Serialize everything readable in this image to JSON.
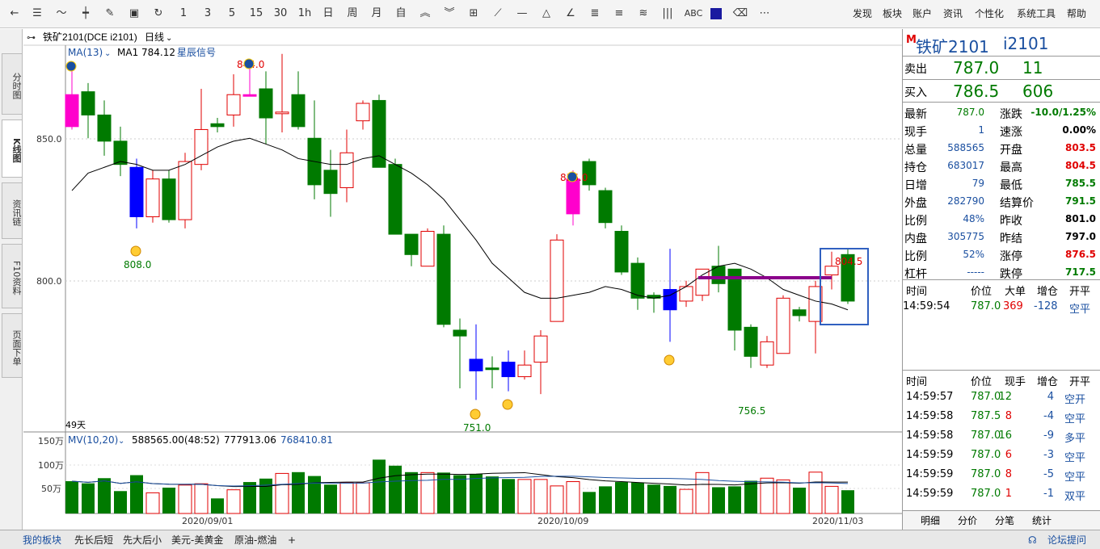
{
  "toolbar": {
    "icons": [
      "back-icon",
      "list-icon",
      "line-chart-icon",
      "candle-icon",
      "adjust-icon",
      "save-icon",
      "refresh-icon"
    ],
    "periods": [
      "1",
      "3",
      "5",
      "15",
      "30",
      "1h",
      "日",
      "周",
      "月",
      "自"
    ],
    "right_menu": [
      "发现",
      "板块",
      "账户",
      "资讯",
      "个性化",
      "系统工具",
      "帮助"
    ],
    "abc": "ABC"
  },
  "left_tabs": [
    "分时图",
    "K线图",
    "资讯链",
    "F10资料",
    "页面下单"
  ],
  "chart": {
    "title": "铁矿2101(DCE i2101)",
    "period": "日线",
    "ma_label": "MA(13)",
    "ma_value": "MA1 784.12",
    "signal": "星辰信号",
    "y_ticks": [
      "850.0",
      "800.0"
    ],
    "days": "49天",
    "low_labels": [
      "808.0",
      "751.0",
      "756.5"
    ],
    "high_labels": [
      "844.0",
      "836.0",
      "804.5"
    ],
    "vol_header": "MV(10,20)",
    "vol_values": [
      "588565.00(48:52)",
      "777913.06",
      "768410.81"
    ],
    "vol_ticks": [
      "150万",
      "100万",
      "50万"
    ],
    "x_dates": [
      "2020/09/01",
      "2020/10/09",
      "2020/11/03"
    ]
  },
  "chart_data": {
    "type": "candlestick",
    "candles": [
      [
        847,
        858,
        846,
        867,
        "m"
      ],
      [
        859,
        851,
        843,
        862,
        "g"
      ],
      [
        851,
        842,
        837,
        856,
        "g"
      ],
      [
        842,
        834,
        830,
        847,
        "g"
      ],
      [
        833,
        816,
        812,
        836,
        "b"
      ],
      [
        816,
        829,
        814,
        832,
        "r"
      ],
      [
        829,
        815,
        814,
        832,
        "g"
      ],
      [
        815,
        835,
        812,
        838,
        "r"
      ],
      [
        834,
        846,
        832,
        860,
        "r"
      ],
      [
        848,
        847,
        845,
        850,
        "g"
      ],
      [
        851,
        858,
        847,
        865,
        "r"
      ],
      [
        858,
        858,
        858,
        869,
        "m"
      ],
      [
        860,
        850,
        841,
        866,
        "g"
      ],
      [
        852,
        852,
        845,
        872,
        "r"
      ],
      [
        858,
        847,
        846,
        866,
        "g"
      ],
      [
        843,
        827,
        822,
        856,
        "g"
      ],
      [
        832,
        824,
        816,
        839,
        "g"
      ],
      [
        826,
        838,
        821,
        846,
        "r"
      ],
      [
        849,
        855,
        846,
        856,
        "r"
      ],
      [
        856,
        833,
        833,
        858,
        "g"
      ],
      [
        834,
        810,
        810,
        836,
        "g"
      ],
      [
        810,
        803,
        799,
        810,
        "g"
      ],
      [
        799,
        811,
        799,
        812,
        "r"
      ],
      [
        810,
        779,
        778,
        813,
        "g"
      ],
      [
        777,
        775,
        757,
        781,
        "g"
      ],
      [
        767,
        763,
        753,
        779,
        "b"
      ],
      [
        764,
        764,
        757,
        768,
        "g"
      ],
      [
        766,
        761,
        756,
        770,
        "b"
      ],
      [
        761,
        765,
        760,
        770,
        "r"
      ],
      [
        766,
        775,
        755,
        777,
        "r"
      ],
      [
        780,
        808,
        780,
        810,
        "r"
      ],
      [
        829,
        817,
        813,
        832,
        "m"
      ],
      [
        835,
        827,
        825,
        836,
        "g"
      ],
      [
        825,
        814,
        812,
        826,
        "g"
      ],
      [
        811,
        797,
        796,
        813,
        "g"
      ],
      [
        800,
        788,
        784,
        802,
        "g"
      ],
      [
        789,
        788,
        783,
        790,
        "g"
      ],
      [
        791,
        784,
        773,
        805,
        "b"
      ],
      [
        787,
        792,
        785,
        794,
        "r"
      ],
      [
        789,
        798,
        787,
        798,
        "r"
      ],
      [
        799,
        793,
        790,
        806,
        "g"
      ],
      [
        798,
        777,
        770,
        798,
        "g"
      ],
      [
        778,
        768,
        764,
        779,
        "g"
      ],
      [
        765,
        773,
        764,
        775,
        "r"
      ],
      [
        769,
        788,
        769,
        789,
        "r"
      ],
      [
        784,
        782,
        780,
        785,
        "g"
      ],
      [
        780,
        792,
        769,
        794,
        "r"
      ],
      [
        796,
        799,
        791,
        804,
        "r"
      ],
      [
        803,
        787,
        786,
        805,
        "g"
      ]
    ],
    "ma13": [
      825,
      831,
      833,
      835,
      834,
      832,
      832,
      834,
      837,
      840,
      842,
      843,
      841,
      839,
      836,
      835,
      834,
      834,
      836,
      837,
      834,
      831,
      827,
      822,
      815,
      808,
      800,
      795,
      790,
      788,
      788,
      789,
      790,
      792,
      791,
      789,
      788,
      789,
      792,
      796,
      799,
      800,
      798,
      795,
      791,
      789,
      787,
      786,
      784
    ],
    "volume": [
      75,
      70,
      82,
      52,
      89,
      48,
      60,
      66,
      69,
      35,
      55,
      73,
      81,
      93,
      96,
      87,
      67,
      72,
      71,
      125,
      111,
      96,
      95,
      95,
      89,
      92,
      86,
      80,
      79,
      79,
      64,
      74,
      50,
      63,
      73,
      72,
      67,
      64,
      56,
      95,
      61,
      63,
      76,
      82,
      78,
      60,
      96,
      63,
      54
    ],
    "vol_colors": [
      "g",
      "g",
      "g",
      "g",
      "g",
      "r",
      "g",
      "r",
      "r",
      "g",
      "r",
      "g",
      "g",
      "r",
      "g",
      "g",
      "g",
      "r",
      "r",
      "g",
      "g",
      "g",
      "r",
      "g",
      "g",
      "b",
      "g",
      "b",
      "r",
      "r",
      "r",
      "m",
      "g",
      "g",
      "g",
      "g",
      "g",
      "b",
      "r",
      "r",
      "g",
      "g",
      "g",
      "r",
      "r",
      "g",
      "r",
      "r",
      "g"
    ],
    "y_range": [
      742,
      875
    ],
    "vol_range": [
      0,
      150
    ]
  },
  "quote": {
    "symbol": "铁矿2101",
    "code": "i2101",
    "sell_label": "卖出",
    "sell_price": "787.0",
    "sell_vol": "11",
    "buy_label": "买入",
    "buy_price": "786.5",
    "buy_vol": "606",
    "left_stats": [
      [
        "最新",
        "787.0"
      ],
      [
        "现手",
        "1"
      ],
      [
        "总量",
        "588565"
      ],
      [
        "持仓",
        "683017"
      ],
      [
        "日增",
        "79"
      ],
      [
        "外盘",
        "282790"
      ],
      [
        "比例",
        "48%"
      ],
      [
        "内盘",
        "305775"
      ],
      [
        "比例",
        "52%"
      ],
      [
        "杠杆",
        "-----"
      ]
    ],
    "right_stats": [
      [
        "涨跌",
        "-10.0/1.25%"
      ],
      [
        "速涨",
        "0.00%"
      ],
      [
        "开盘",
        "803.5"
      ],
      [
        "最高",
        "804.5"
      ],
      [
        "最低",
        "785.5"
      ],
      [
        "结算价",
        "791.5"
      ],
      [
        "昨收",
        "801.0"
      ],
      [
        "昨结",
        "797.0"
      ],
      [
        "涨停",
        "876.5"
      ],
      [
        "跌停",
        "717.5"
      ]
    ]
  },
  "big_trades": {
    "headers": [
      "时间",
      "价位",
      "大单",
      "增仓",
      "开平"
    ],
    "rows": [
      [
        "14:59:54",
        "787.0",
        "369",
        "-128",
        "空平"
      ]
    ]
  },
  "ticks": {
    "headers": [
      "时间",
      "价位",
      "现手",
      "增仓",
      "开平"
    ],
    "rows": [
      [
        "14:59:57",
        "787.0",
        "12",
        "4",
        "空开"
      ],
      [
        "14:59:58",
        "787.5",
        "8",
        "-4",
        "空平"
      ],
      [
        "14:59:58",
        "787.0",
        "16",
        "-9",
        "多平"
      ],
      [
        "14:59:59",
        "787.0",
        "6",
        "-3",
        "空平"
      ],
      [
        "14:59:59",
        "787.0",
        "8",
        "-5",
        "空平"
      ],
      [
        "14:59:59",
        "787.0",
        "1",
        "-1",
        "双平"
      ]
    ]
  },
  "right_bottom_tabs": [
    "明细",
    "分价",
    "分笔",
    "统计"
  ],
  "bottom_tabs": [
    "我的板块",
    "先长后短",
    "先大后小",
    "美元-美黄金",
    "原油-燃油",
    "+"
  ],
  "forum": "论坛提问",
  "colors": {
    "up": "#e00000",
    "down": "#007a00",
    "magenta": "#ff00cc",
    "blue": "#0000ff",
    "purple": "#8b008b"
  }
}
